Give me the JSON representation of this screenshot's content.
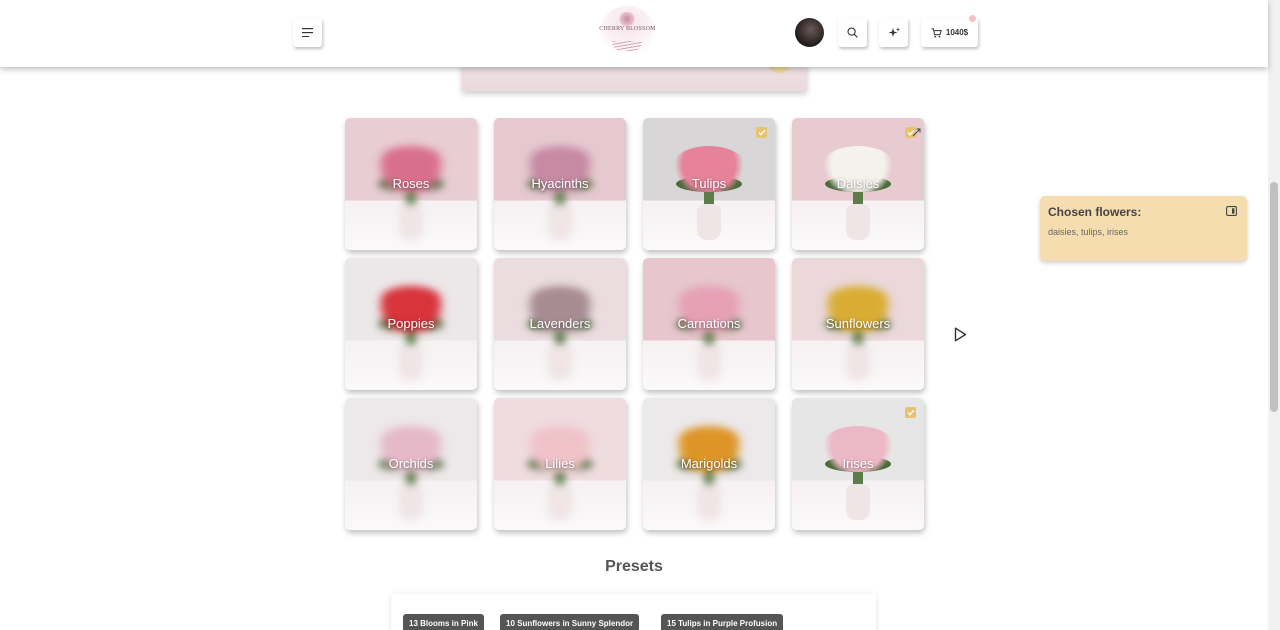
{
  "header": {
    "logo_text": "CHERRY BLOSSOM",
    "cart_total": "1040$"
  },
  "flowers": [
    {
      "label": "Roses",
      "selected": false,
      "blurred": true,
      "bloom_color": "#d96f8c",
      "bg": "#e8cdd3"
    },
    {
      "label": "Hyacinths",
      "selected": false,
      "blurred": true,
      "bloom_color": "#c68aa3",
      "bg": "#e6c9d0"
    },
    {
      "label": "Tulips",
      "selected": true,
      "blurred": false,
      "bloom_color": "#e6839a",
      "bg": "#d8d6d6"
    },
    {
      "label": "Daisies",
      "selected": true,
      "blurred": false,
      "bloom_color": "#f4f2ea",
      "bg": "#e8cbd1"
    },
    {
      "label": "Poppies",
      "selected": false,
      "blurred": true,
      "bloom_color": "#d7343c",
      "bg": "#ece7e8"
    },
    {
      "label": "Lavenders",
      "selected": false,
      "blurred": true,
      "bloom_color": "#a88c94",
      "bg": "#eadcdf"
    },
    {
      "label": "Carnations",
      "selected": false,
      "blurred": true,
      "bloom_color": "#e5a0b6",
      "bg": "#e7c6cd"
    },
    {
      "label": "Sunflowers",
      "selected": false,
      "blurred": true,
      "bloom_color": "#d9ad33",
      "bg": "#ead8da"
    },
    {
      "label": "Orchids",
      "selected": false,
      "blurred": true,
      "bloom_color": "#e5b9c8",
      "bg": "#ede8e9"
    },
    {
      "label": "Lilies",
      "selected": false,
      "blurred": true,
      "bloom_color": "#f0c3c9",
      "bg": "#efdcdf"
    },
    {
      "label": "Marigolds",
      "selected": false,
      "blurred": true,
      "bloom_color": "#dd9528",
      "bg": "#ece9ea"
    },
    {
      "label": "Irises",
      "selected": true,
      "blurred": false,
      "bloom_color": "#edb8c5",
      "bg": "#e6e6e6"
    }
  ],
  "chosen": {
    "title": "Chosen flowers:",
    "list": "daisies, tulips, irises"
  },
  "presets": {
    "title": "Presets",
    "chips": [
      "13 Blooms in Pink",
      "10 Sunflowers in Sunny Splendor",
      "15 Tulips in Purple Profusion"
    ]
  },
  "icons": [
    "menu-icon",
    "search-icon",
    "sparkle-icon",
    "cart-icon",
    "checkbox-icon",
    "expand-icon",
    "panel-icon",
    "play-cursor-icon"
  ]
}
